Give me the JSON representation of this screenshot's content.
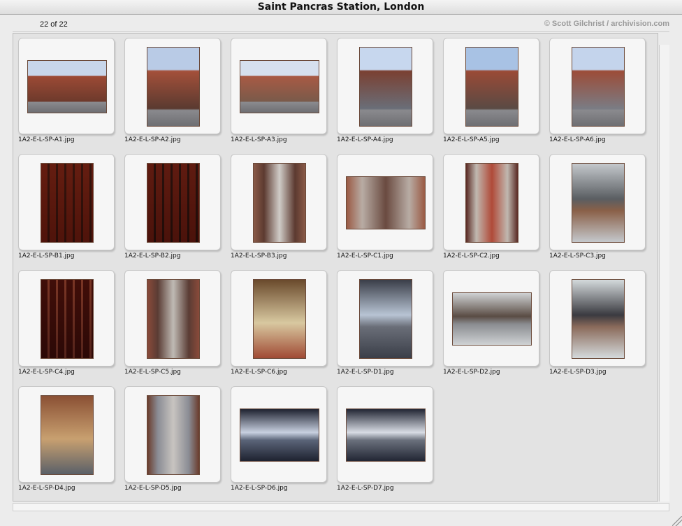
{
  "window": {
    "title": "Saint Pancras Station, London"
  },
  "header": {
    "count_text": "22 of 22",
    "credit": "© Scott Gilchrist / archivision.com"
  },
  "thumbnails": [
    {
      "file": "1A2-E-L-SP-A1.jpg",
      "orientation": "landscape",
      "scene": "exterior",
      "colors": [
        "#c8d6ea",
        "#9c4a35",
        "#6e3a2c"
      ]
    },
    {
      "file": "1A2-E-L-SP-A2.jpg",
      "orientation": "portrait",
      "scene": "exterior",
      "colors": [
        "#b9cbe6",
        "#a4503a",
        "#5a3a30"
      ]
    },
    {
      "file": "1A2-E-L-SP-A3.jpg",
      "orientation": "landscape",
      "scene": "exterior",
      "colors": [
        "#d6e0ee",
        "#a85a44",
        "#7a5a4a"
      ]
    },
    {
      "file": "1A2-E-L-SP-A4.jpg",
      "orientation": "portrait",
      "scene": "exterior",
      "colors": [
        "#c7d7ee",
        "#7a4032",
        "#6a6e78"
      ]
    },
    {
      "file": "1A2-E-L-SP-A5.jpg",
      "orientation": "portrait",
      "scene": "exterior",
      "colors": [
        "#a8c2e4",
        "#9a4a36",
        "#5a4a44"
      ]
    },
    {
      "file": "1A2-E-L-SP-A6.jpg",
      "orientation": "portrait",
      "scene": "exterior",
      "colors": [
        "#c4d4ec",
        "#9c4c38",
        "#7a7c84"
      ]
    },
    {
      "file": "1A2-E-L-SP-B1.jpg",
      "orientation": "portrait",
      "scene": "facade",
      "colors": [
        "#b56a50",
        "#8e4634",
        "#4c3028"
      ]
    },
    {
      "file": "1A2-E-L-SP-B2.jpg",
      "orientation": "portrait",
      "scene": "facade",
      "colors": [
        "#b06650",
        "#8a4434",
        "#3c2c28"
      ]
    },
    {
      "file": "1A2-E-L-SP-B3.jpg",
      "orientation": "portrait",
      "scene": "arcade",
      "colors": [
        "#8a5a48",
        "#d0ccc8",
        "#5c3a30"
      ]
    },
    {
      "file": "1A2-E-L-SP-C1.jpg",
      "orientation": "landscape",
      "scene": "arcade",
      "colors": [
        "#9a5a44",
        "#6a4a40",
        "#b8aca4"
      ]
    },
    {
      "file": "1A2-E-L-SP-C2.jpg",
      "orientation": "portrait",
      "scene": "arcade",
      "colors": [
        "#5a2a24",
        "#b04a38",
        "#c0b8b0"
      ]
    },
    {
      "file": "1A2-E-L-SP-C3.jpg",
      "orientation": "portrait",
      "scene": "trainshed",
      "colors": [
        "#c4c8cc",
        "#5a5e62",
        "#8a6048"
      ]
    },
    {
      "file": "1A2-E-L-SP-C4.jpg",
      "orientation": "portrait",
      "scene": "facade",
      "colors": [
        "#9a4a38",
        "#6a3028",
        "#cabaa8"
      ]
    },
    {
      "file": "1A2-E-L-SP-C5.jpg",
      "orientation": "portrait",
      "scene": "arcade",
      "colors": [
        "#8a4a3a",
        "#bfbab4",
        "#5a3c34"
      ]
    },
    {
      "file": "1A2-E-L-SP-C6.jpg",
      "orientation": "portrait",
      "scene": "interior",
      "colors": [
        "#6a4a2c",
        "#d8c8a0",
        "#a04a34"
      ]
    },
    {
      "file": "1A2-E-L-SP-D1.jpg",
      "orientation": "portrait",
      "scene": "trainshed",
      "colors": [
        "#3a3e48",
        "#b8c4d4",
        "#6a6e78"
      ]
    },
    {
      "file": "1A2-E-L-SP-D2.jpg",
      "orientation": "landscape",
      "scene": "trainshed",
      "colors": [
        "#cfd2d4",
        "#5a4c44",
        "#8a8c90"
      ]
    },
    {
      "file": "1A2-E-L-SP-D3.jpg",
      "orientation": "portrait",
      "scene": "trainshed",
      "colors": [
        "#d4dadc",
        "#3a3a40",
        "#8a6a5a"
      ]
    },
    {
      "file": "1A2-E-L-SP-D4.jpg",
      "orientation": "portrait",
      "scene": "interior",
      "colors": [
        "#8a5034",
        "#c8a070",
        "#5a6068"
      ]
    },
    {
      "file": "1A2-E-L-SP-D5.jpg",
      "orientation": "portrait",
      "scene": "arcade",
      "colors": [
        "#6a3c2c",
        "#c8c4c0",
        "#8a8c94"
      ]
    },
    {
      "file": "1A2-E-L-SP-D6.jpg",
      "orientation": "landscape",
      "scene": "trainshed",
      "colors": [
        "#1e2230",
        "#c8d0e0",
        "#5a6478"
      ]
    },
    {
      "file": "1A2-E-L-SP-D7.jpg",
      "orientation": "landscape",
      "scene": "trainshed",
      "colors": [
        "#222634",
        "#d8dce4",
        "#6a707c"
      ]
    }
  ]
}
